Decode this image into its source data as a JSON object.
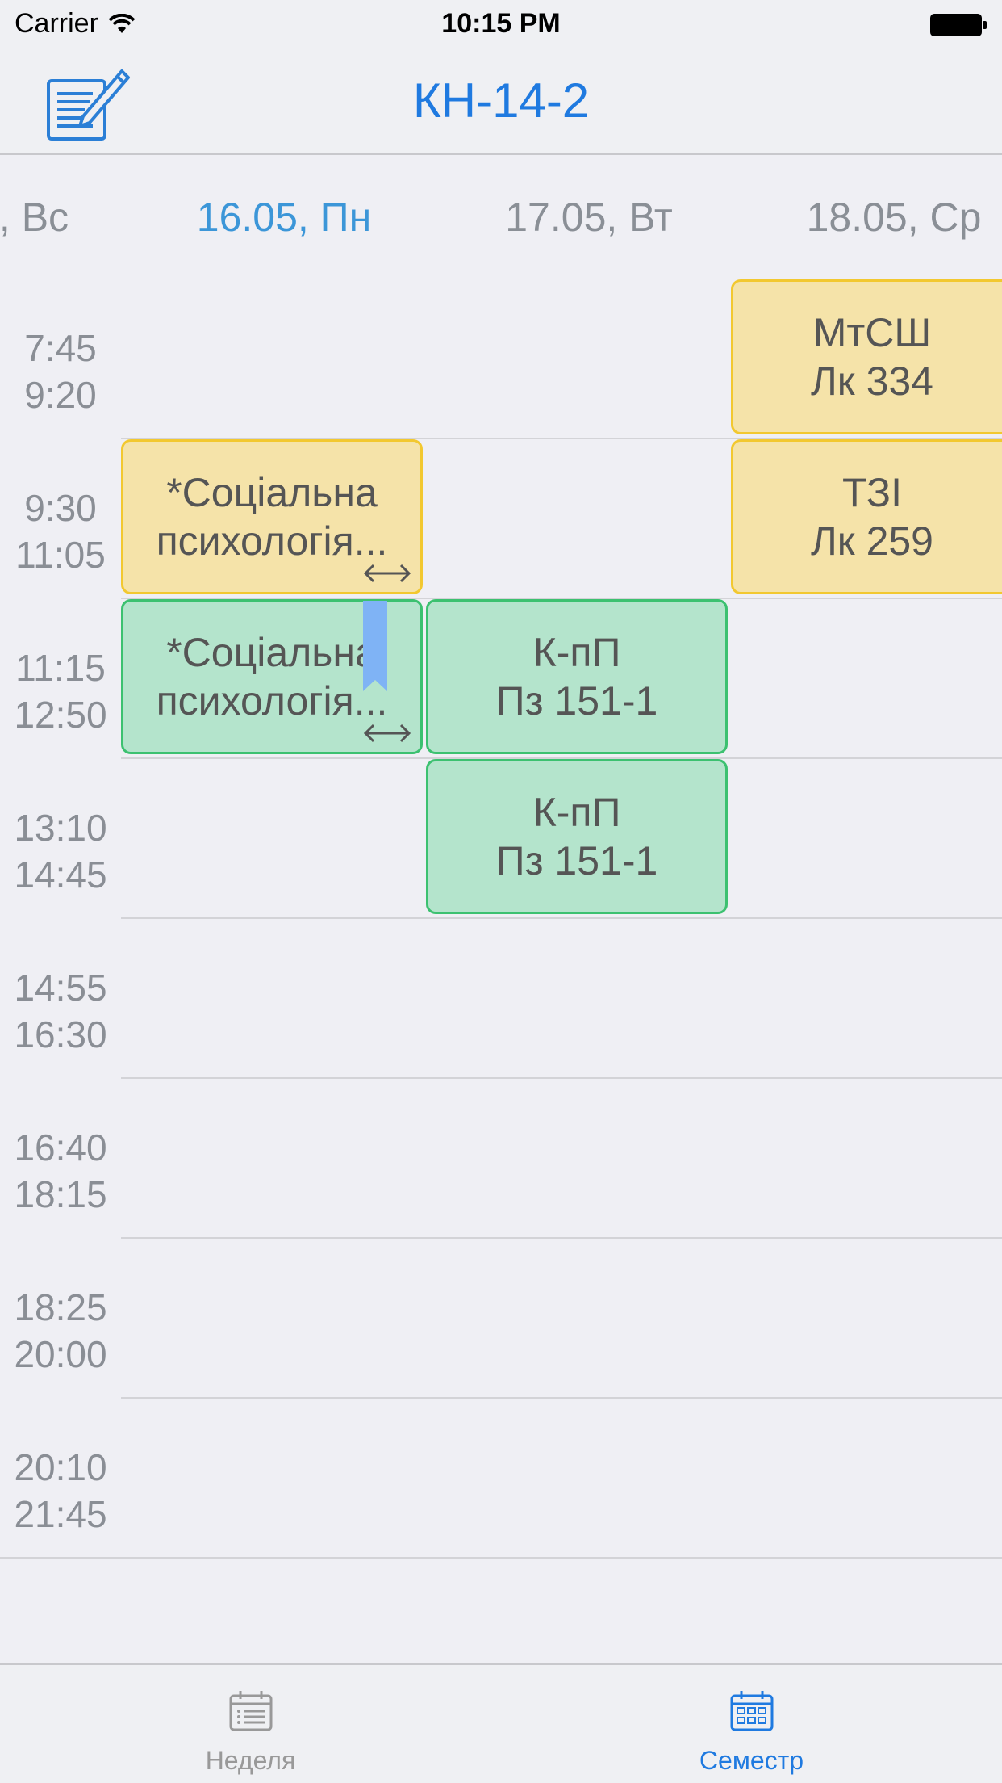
{
  "status_bar": {
    "carrier": "Carrier",
    "time": "10:15 PM"
  },
  "nav": {
    "title": "КН-14-2",
    "edit_icon": "edit-note-icon"
  },
  "days": [
    {
      "label": ", Вс"
    },
    {
      "label": "16.05, Пн"
    },
    {
      "label": "17.05, Вт"
    },
    {
      "label": "18.05, Ср"
    }
  ],
  "time_slots": [
    {
      "start": "7:45",
      "end": "9:20"
    },
    {
      "start": "9:30",
      "end": "11:05"
    },
    {
      "start": "11:15",
      "end": "12:50"
    },
    {
      "start": "13:10",
      "end": "14:45"
    },
    {
      "start": "14:55",
      "end": "16:30"
    },
    {
      "start": "16:40",
      "end": "18:15"
    },
    {
      "start": "18:25",
      "end": "20:00"
    },
    {
      "start": "20:10",
      "end": "21:45"
    }
  ],
  "lessons": [
    {
      "line1": "МтСШ",
      "line2": "Лк 334"
    },
    {
      "line1": "*Соціальна",
      "line2": "психологія..."
    },
    {
      "line1": "ТЗІ",
      "line2": "Лк 259"
    },
    {
      "line1": "*Соціальна",
      "line2": "психологія..."
    },
    {
      "line1": "К-пП",
      "line2": "Пз 151-1"
    },
    {
      "line1": "К-пП",
      "line2": "Пз 151-1"
    }
  ],
  "tabs": [
    {
      "label": "Неделя",
      "icon": "week-list-icon"
    },
    {
      "label": "Семестр",
      "icon": "semester-calendar-icon"
    }
  ],
  "colors": {
    "accent": "#1f7ae0",
    "lecture": "#f5e3a9",
    "practice": "#b4e4cc"
  }
}
